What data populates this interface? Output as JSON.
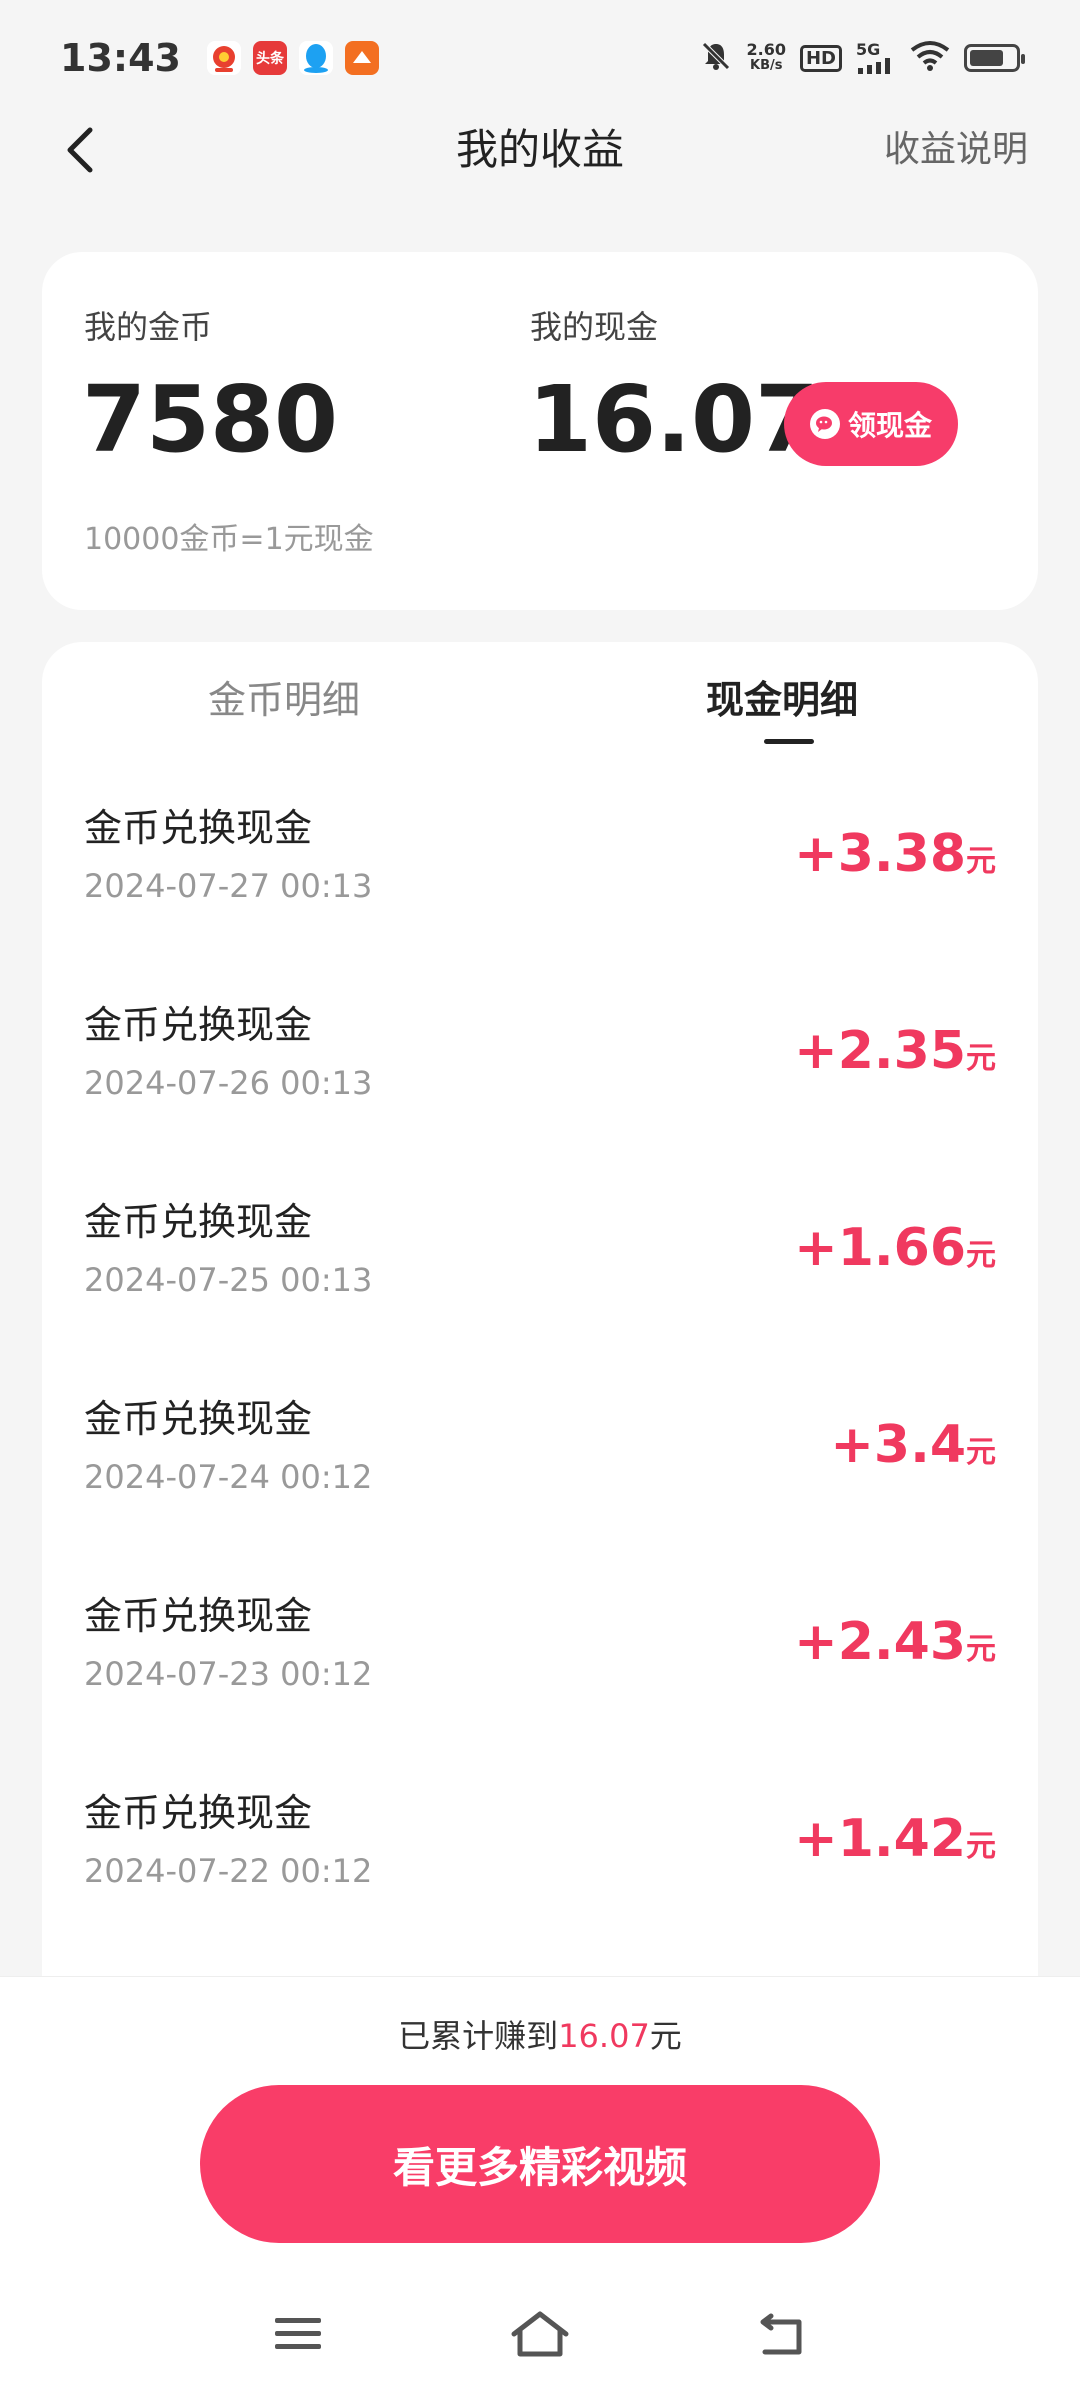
{
  "status_bar": {
    "time": "13:43",
    "app_icons": [
      {
        "name": "app-icon-red",
        "label": "",
        "color": "#e8402f"
      },
      {
        "name": "toutiao-icon",
        "label": "头条",
        "color": "#e63a3a"
      },
      {
        "name": "qq-icon",
        "label": "",
        "color": "#1da1f2"
      },
      {
        "name": "app-icon-orange",
        "label": "",
        "color": "#f36f21"
      }
    ],
    "speed_value": "2.60",
    "speed_unit": "KB/s",
    "hd_label": "HD",
    "network_label": "5G",
    "battery_level": 0.75
  },
  "header": {
    "title": "我的收益",
    "link": "收益说明"
  },
  "summary": {
    "coin_label": "我的金币",
    "coin_value": "7580",
    "cash_label": "我的现金",
    "cash_value": "16.07",
    "withdraw_label": "领现金",
    "rate_text": "10000金币=1元现金"
  },
  "tabs": {
    "coins": "金币明细",
    "cash": "现金明细",
    "active": "cash"
  },
  "records": [
    {
      "title": "金币兑换现金",
      "time": "2024-07-27 00:13",
      "amount": "+3.38",
      "unit": "元"
    },
    {
      "title": "金币兑换现金",
      "time": "2024-07-26 00:13",
      "amount": "+2.35",
      "unit": "元"
    },
    {
      "title": "金币兑换现金",
      "time": "2024-07-25 00:13",
      "amount": "+1.66",
      "unit": "元"
    },
    {
      "title": "金币兑换现金",
      "time": "2024-07-24 00:12",
      "amount": "+3.4",
      "unit": "元"
    },
    {
      "title": "金币兑换现金",
      "time": "2024-07-23 00:12",
      "amount": "+2.43",
      "unit": "元"
    },
    {
      "title": "金币兑换现金",
      "time": "2024-07-22 00:12",
      "amount": "+1.42",
      "unit": "元"
    }
  ],
  "footer": {
    "total_prefix": "已累计赚到",
    "total_value": "16.07",
    "total_suffix": "元",
    "cta_label": "看更多精彩视频"
  },
  "colors": {
    "accent": "#f0395f",
    "background": "#f5f5f5"
  }
}
